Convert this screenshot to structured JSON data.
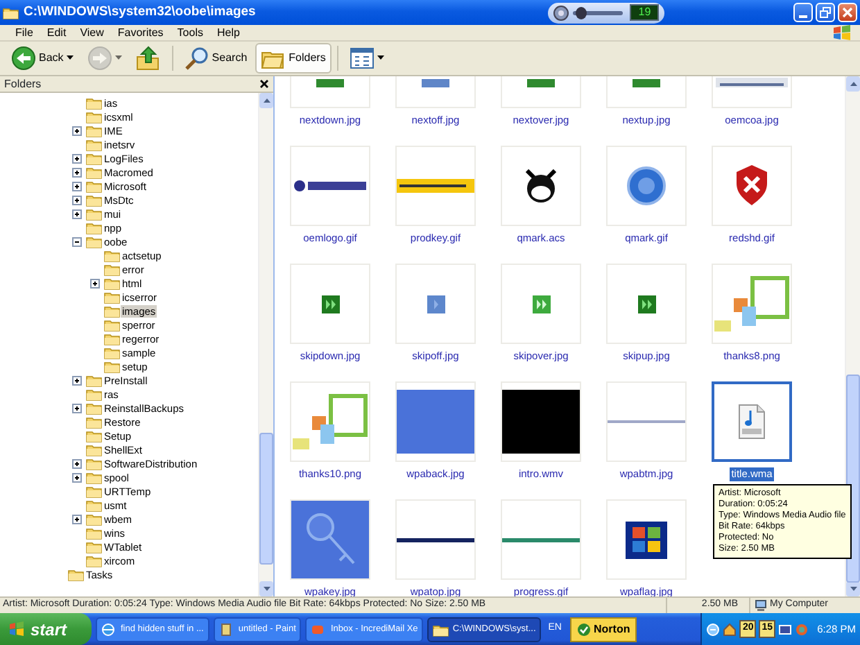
{
  "window": {
    "title": "C:\\WINDOWS\\system32\\oobe\\images"
  },
  "media_bar": {
    "reading": "19",
    "level": 0.15
  },
  "menu": [
    "File",
    "Edit",
    "View",
    "Favorites",
    "Tools",
    "Help"
  ],
  "toolbar": [
    {
      "kind": "back",
      "label": "Back",
      "disabled": false,
      "pressed": false
    },
    {
      "kind": "forward",
      "disabled": true,
      "pressed": false
    },
    {
      "kind": "up",
      "disabled": false,
      "pressed": false
    },
    {
      "kind": "search",
      "label": "Search",
      "disabled": false,
      "pressed": false
    },
    {
      "kind": "folders",
      "label": "Folders",
      "disabled": false,
      "pressed": true
    },
    {
      "kind": "views",
      "disabled": false,
      "pressed": false
    }
  ],
  "folders_pane": {
    "title": "Folders",
    "tree": [
      {
        "children": [
          {
            "label": "ias",
            "kind": "leaf",
            "selected": false
          },
          {
            "label": "icsxml",
            "kind": "leaf",
            "selected": false
          },
          {
            "label": "IME",
            "kind": "collapsed",
            "selected": false
          },
          {
            "label": "inetsrv",
            "kind": "leaf",
            "selected": false
          },
          {
            "label": "LogFiles",
            "kind": "collapsed",
            "selected": false
          },
          {
            "label": "Macromed",
            "kind": "collapsed",
            "selected": false
          },
          {
            "label": "Microsoft",
            "kind": "collapsed",
            "selected": false
          },
          {
            "label": "MsDtc",
            "kind": "collapsed",
            "selected": false
          },
          {
            "label": "mui",
            "kind": "collapsed",
            "selected": false
          },
          {
            "label": "npp",
            "kind": "leaf",
            "selected": false
          },
          {
            "label": "oobe",
            "kind": "expanded",
            "selected": false,
            "children": [
              {
                "label": "actsetup",
                "kind": "leaf",
                "selected": false
              },
              {
                "label": "error",
                "kind": "leaf",
                "selected": false
              },
              {
                "label": "html",
                "kind": "collapsed",
                "selected": false
              },
              {
                "label": "icserror",
                "kind": "leaf",
                "selected": false
              },
              {
                "label": "images",
                "kind": "leaf",
                "selected": true
              },
              {
                "label": "sperror",
                "kind": "leaf",
                "selected": false
              },
              {
                "label": "regerror",
                "kind": "leaf",
                "selected": false
              },
              {
                "label": "sample",
                "kind": "leaf",
                "selected": false
              },
              {
                "label": "setup",
                "kind": "leaf",
                "selected": false
              }
            ]
          },
          {
            "label": "PreInstall",
            "kind": "collapsed",
            "selected": false
          },
          {
            "label": "ras",
            "kind": "leaf",
            "selected": false
          },
          {
            "label": "ReinstallBackups",
            "kind": "collapsed",
            "selected": false
          },
          {
            "label": "Restore",
            "kind": "leaf",
            "selected": false
          },
          {
            "label": "Setup",
            "kind": "leaf",
            "selected": false
          },
          {
            "label": "ShellExt",
            "kind": "leaf",
            "selected": false
          },
          {
            "label": "SoftwareDistribution",
            "kind": "collapsed",
            "selected": false
          },
          {
            "label": "spool",
            "kind": "collapsed",
            "selected": false
          },
          {
            "label": "URTTemp",
            "kind": "leaf",
            "selected": false
          },
          {
            "label": "usmt",
            "kind": "leaf",
            "selected": false
          },
          {
            "label": "wbem",
            "kind": "collapsed",
            "selected": false
          },
          {
            "label": "wins",
            "kind": "leaf",
            "selected": false
          },
          {
            "label": "WTablet",
            "kind": "leaf",
            "selected": false
          },
          {
            "label": "xircom",
            "kind": "leaf",
            "selected": false
          }
        ]
      },
      {
        "label": "Tasks",
        "kind": "leaf",
        "selected": false
      }
    ]
  },
  "files": [
    {
      "name": "nextdown.jpg",
      "kind": "picture",
      "selected": false
    },
    {
      "name": "nextoff.jpg",
      "kind": "picture",
      "selected": false
    },
    {
      "name": "nextover.jpg",
      "kind": "picture",
      "selected": false
    },
    {
      "name": "nextup.jpg",
      "kind": "picture",
      "selected": false
    },
    {
      "name": "oemcoa.jpg",
      "kind": "picture",
      "selected": false
    },
    {
      "name": "oemlogo.gif",
      "kind": "picture",
      "selected": false
    },
    {
      "name": "prodkey.gif",
      "kind": "picture",
      "selected": false
    },
    {
      "name": "qmark.acs",
      "kind": "picture",
      "selected": false
    },
    {
      "name": "qmark.gif",
      "kind": "picture",
      "selected": false
    },
    {
      "name": "redshd.gif",
      "kind": "picture",
      "selected": false
    },
    {
      "name": "skipdown.jpg",
      "kind": "picture",
      "selected": false
    },
    {
      "name": "skipoff.jpg",
      "kind": "picture",
      "selected": false
    },
    {
      "name": "skipover.jpg",
      "kind": "picture",
      "selected": false
    },
    {
      "name": "skipup.jpg",
      "kind": "picture",
      "selected": false
    },
    {
      "name": "thanks8.png",
      "kind": "picture",
      "selected": false
    },
    {
      "name": "thanks10.png",
      "kind": "picture",
      "selected": false
    },
    {
      "name": "wpaback.jpg",
      "kind": "picture",
      "selected": false
    },
    {
      "name": "intro.wmv",
      "kind": "picture",
      "selected": false
    },
    {
      "name": "wpabtm.jpg",
      "kind": "picture",
      "selected": false
    },
    {
      "name": "title.wma",
      "kind": "audio",
      "selected": true
    },
    {
      "name": "wpakey.jpg",
      "kind": "picture",
      "selected": false
    },
    {
      "name": "wpatop.jpg",
      "kind": "picture",
      "selected": false
    },
    {
      "name": "progress.gif",
      "kind": "picture",
      "selected": false
    },
    {
      "name": "wpaflag.jpg",
      "kind": "picture",
      "selected": false
    }
  ],
  "tooltip": {
    "lines": [
      "Artist: Microsoft",
      "Duration: 0:05:24",
      "Type: Windows Media Audio file",
      "Bit Rate: 64kbps",
      "Protected: No",
      "Size: 2.50 MB"
    ]
  },
  "status_bar": {
    "text": "Artist: Microsoft Duration: 0:05:24 Type: Windows Media Audio file Bit Rate: 64kbps Protected: No Size: 2.50 MB",
    "size": "2.50 MB",
    "zone": "My Computer"
  },
  "taskbar": {
    "start": "start",
    "tasks": [
      {
        "label": "find hidden stuff in ...",
        "kind": "browser",
        "selected": false
      },
      {
        "label": "untitled - Paint",
        "kind": "paint",
        "selected": false
      },
      {
        "label": "Inbox - IncrediMail Xe",
        "kind": "mail",
        "selected": false
      },
      {
        "label": "C:\\WINDOWS\\syst...",
        "kind": "folder",
        "selected": true
      }
    ],
    "language": "EN",
    "norton": "Norton",
    "tray_badges": [
      "20",
      "15"
    ],
    "clock": "6:28 PM"
  }
}
